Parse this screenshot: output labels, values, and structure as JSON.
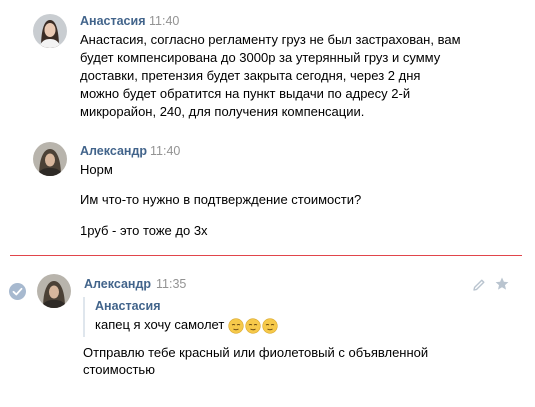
{
  "messages": [
    {
      "author": "Анастасия",
      "time": "11:40",
      "lines": [
        "Анастасия, согласно регламенту груз не был застрахован, вам",
        "будет компенсирована до 3000р за утерянный груз и сумму",
        "доставки, претензия будет закрыта сегодня, через 2 дня",
        "можно будет обратится на пункт выдачи по адресу 2-й",
        "микрорайон, 240, для получения компенсации."
      ]
    },
    {
      "author": "Александр",
      "time": "11:40",
      "lines": [
        "Норм",
        "Им что-то нужно в подтверждение стоимости?",
        "1руб - это тоже до 3х"
      ]
    },
    {
      "author": "Александр",
      "time": "11:35",
      "quote": {
        "author": "Анастасия",
        "text": "капец я хочу самолет",
        "emoji": [
          "relieved-face-emoji",
          "relieved-face-emoji",
          "relieved-face-emoji"
        ]
      },
      "lines": [
        "Отправлю тебе красный или фиолетовый с объявленной",
        "стоимостью"
      ]
    }
  ],
  "icons": {
    "selected": "checkmark-icon",
    "edit": "pencil-icon",
    "favorite": "star-icon"
  },
  "colors": {
    "author": "#42648b",
    "time": "#939393",
    "divider": "#e1454b",
    "selected_check": "#a7b9cf"
  }
}
